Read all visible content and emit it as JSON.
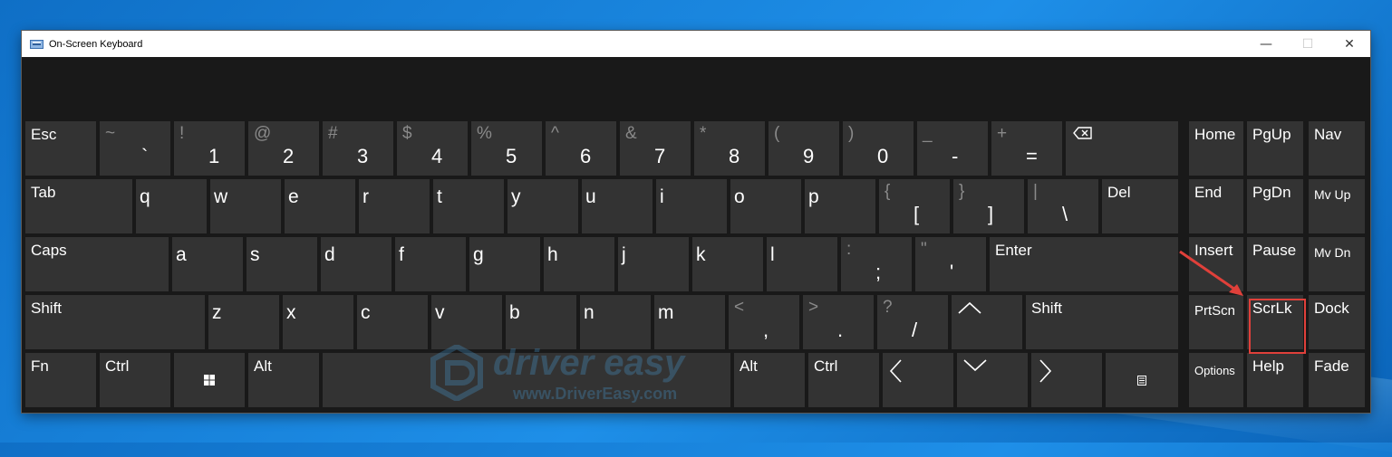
{
  "window": {
    "title": "On-Screen Keyboard",
    "controls": [
      {
        "name": "minimize-button",
        "glyph": "—",
        "enabled": true
      },
      {
        "name": "maximize-button",
        "glyph": "☐",
        "enabled": false
      },
      {
        "name": "close-button",
        "glyph": "✕",
        "enabled": true
      }
    ]
  },
  "colors": {
    "key_bg": "#333333",
    "keyboard_bg": "#191919",
    "highlight": "#e0403a",
    "desktop": "#1e8fe8"
  },
  "keys": {
    "esc": "Esc",
    "tilde_sym": "~",
    "tilde_main": "`",
    "1_sym": "!",
    "1_main": "1",
    "2_sym": "@",
    "2_main": "2",
    "3_sym": "#",
    "3_main": "3",
    "4_sym": "$",
    "4_main": "4",
    "5_sym": "%",
    "5_main": "5",
    "6_sym": "^",
    "6_main": "6",
    "7_sym": "&",
    "7_main": "7",
    "8_sym": "*",
    "8_main": "8",
    "9_sym": "(",
    "9_main": "9",
    "0_sym": ")",
    "0_main": "0",
    "minus_sym": "_",
    "minus_main": "-",
    "equals_sym": "+",
    "equals_main": "=",
    "backspace_icon": "backspace-icon",
    "home": "Home",
    "pgup": "PgUp",
    "nav": "Nav",
    "tab": "Tab",
    "q": "q",
    "w": "w",
    "e": "e",
    "r": "r",
    "t": "t",
    "y": "y",
    "u": "u",
    "i": "i",
    "o": "o",
    "p": "p",
    "lbracket_sym": "{",
    "lbracket_main": "[",
    "rbracket_sym": "}",
    "rbracket_main": "]",
    "backslash_sym": "|",
    "backslash_main": "\\",
    "del": "Del",
    "end": "End",
    "pgdn": "PgDn",
    "mvup": "Mv Up",
    "caps": "Caps",
    "a": "a",
    "s": "s",
    "d": "d",
    "f": "f",
    "g": "g",
    "h": "h",
    "j": "j",
    "k": "k",
    "l": "l",
    "semicolon_sym": ":",
    "semicolon_main": ";",
    "quote_sym": "\"",
    "quote_main": "'",
    "enter": "Enter",
    "insert": "Insert",
    "pause": "Pause",
    "mvdn": "Mv Dn",
    "shift": "Shift",
    "z": "z",
    "x": "x",
    "c": "c",
    "v": "v",
    "b": "b",
    "n": "n",
    "m": "m",
    "comma_sym": "<",
    "comma_main": ",",
    "period_sym": ">",
    "period_main": ".",
    "slash_sym": "?",
    "slash_main": "/",
    "up_icon": "chevron-up-icon",
    "shift_r": "Shift",
    "prtscn": "PrtScn",
    "scrlk": "ScrLk",
    "dock": "Dock",
    "fn": "Fn",
    "ctrl": "Ctrl",
    "win_icon": "windows-icon",
    "alt": "Alt",
    "alt_r": "Alt",
    "ctrl_r": "Ctrl",
    "left_icon": "chevron-left-icon",
    "down_icon": "chevron-down-icon",
    "right_icon": "chevron-right-icon",
    "menu_icon": "menu-icon",
    "options": "Options",
    "help": "Help",
    "fade": "Fade"
  },
  "watermark": {
    "brand": "driver easy",
    "url": "www.DriverEasy.com"
  }
}
